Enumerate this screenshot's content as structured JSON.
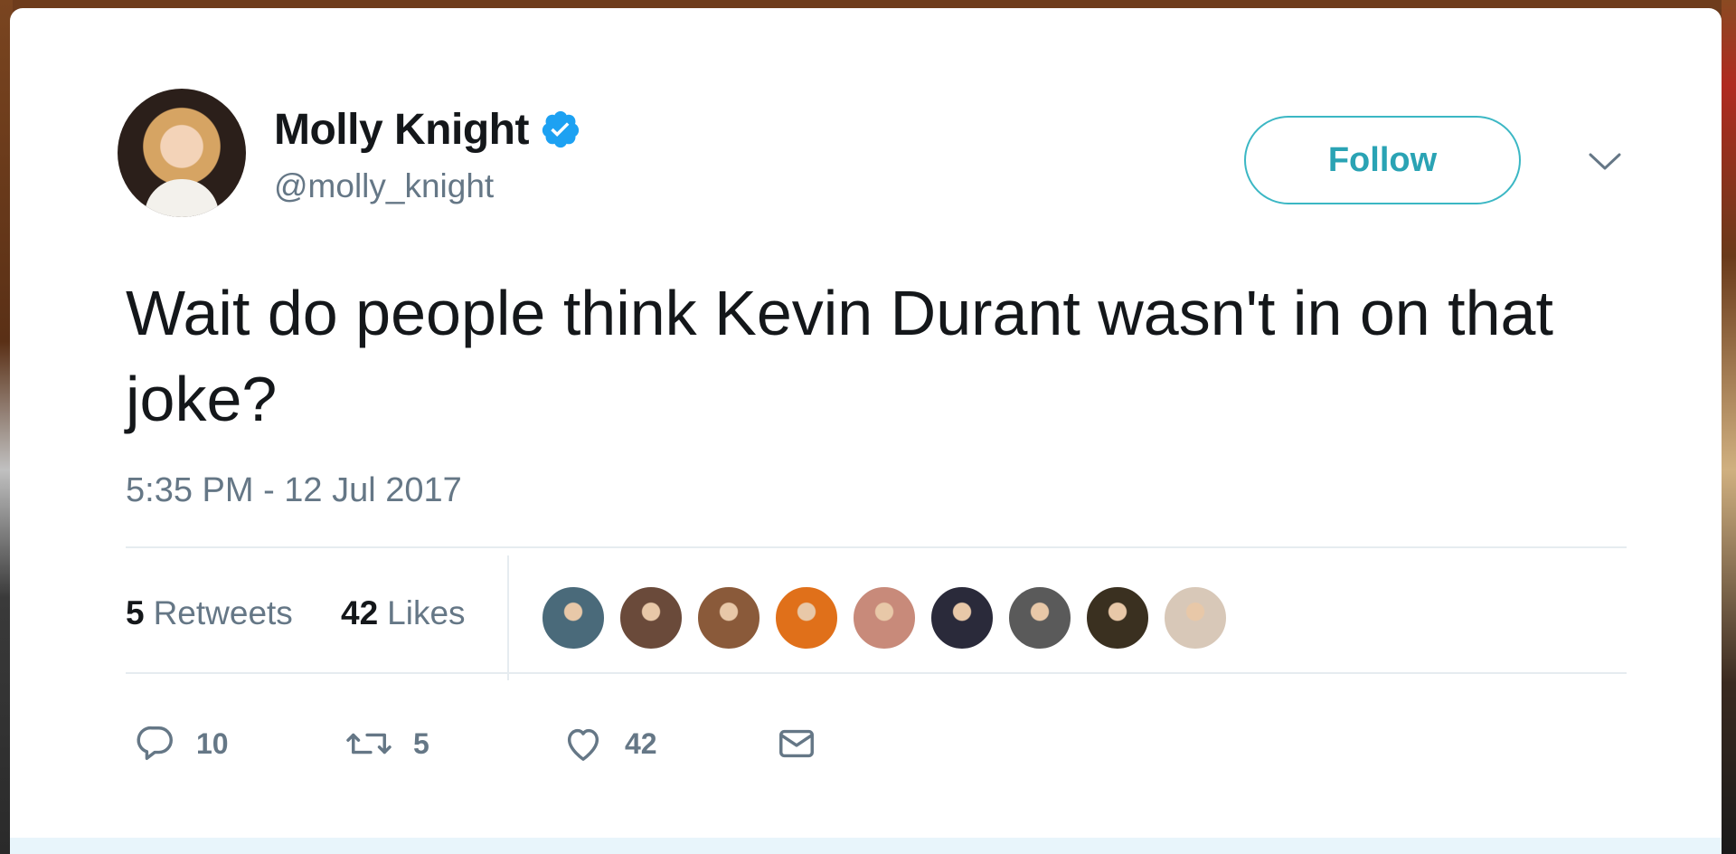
{
  "author": {
    "display_name": "Molly Knight",
    "handle": "@molly_knight",
    "verified": true,
    "avatar_icon": "profile-photo"
  },
  "follow_button": {
    "label": "Follow"
  },
  "tweet": {
    "text": "Wait do people think Kevin Durant wasn't in on that joke?",
    "timestamp": "5:35 PM - 12 Jul 2017"
  },
  "stats": {
    "retweets_count": "5",
    "retweets_label": "Retweets",
    "likes_count": "42",
    "likes_label": "Likes"
  },
  "likers": [
    {
      "color": "#4a6a7a"
    },
    {
      "color": "#6a4a3a"
    },
    {
      "color": "#8a5a3a"
    },
    {
      "color": "#e0701a"
    },
    {
      "color": "#c88a7a"
    },
    {
      "color": "#2a2a3a"
    },
    {
      "color": "#5a5a5a"
    },
    {
      "color": "#3a3020"
    },
    {
      "color": "#d8c8b8"
    }
  ],
  "actions": {
    "reply_count": "10",
    "retweet_count": "5",
    "like_count": "42"
  },
  "colors": {
    "accent": "#1da1f2",
    "follow_text": "#2aa3b4",
    "secondary_text": "#657786",
    "primary_text": "#14171a"
  }
}
